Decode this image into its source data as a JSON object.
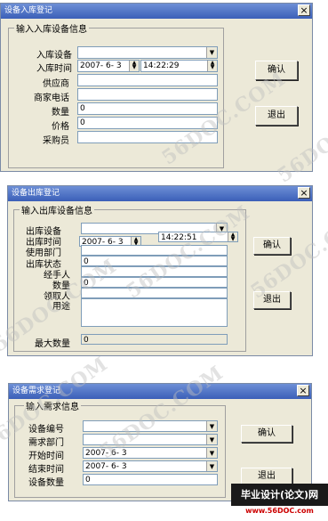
{
  "window1": {
    "title": "设备入库登记",
    "group_title": "输入入库设备信息",
    "labels": {
      "device": "入库设备",
      "time": "入库时间",
      "supplier": "供应商",
      "phone": "商家电话",
      "qty": "数量",
      "price": "价格",
      "buyer": "采购员"
    },
    "values": {
      "device": "",
      "date": "2007- 6- 3",
      "time": "14:22:29",
      "supplier": "",
      "phone": "",
      "qty": "0",
      "price": "0",
      "buyer": ""
    },
    "confirm_label": "确认",
    "exit_label": "退出",
    "close_glyph": "×"
  },
  "window2": {
    "title": "设备出库登记",
    "group_title": "输入出库设备信息",
    "labels": {
      "device": "出库设备",
      "time": "出库时间",
      "dept": "使用部门",
      "status": "出库状态",
      "handler": "经手人",
      "qty": "数量",
      "receiver": "领取人",
      "purpose": "用途",
      "max_qty": "最大数量"
    },
    "values": {
      "device": "",
      "date": "2007- 6- 3",
      "time": "14:22:51",
      "dept": "",
      "status": "0",
      "handler": "",
      "qty": "0",
      "receiver": "",
      "purpose": "",
      "max_qty": "0"
    },
    "confirm_label": "确认",
    "exit_label": "退出",
    "close_glyph": "×"
  },
  "window3": {
    "title": "设备需求登记",
    "group_title": "输入需求信息",
    "labels": {
      "device_id": "设备编号",
      "dept": "需求部门",
      "start": "开始时间",
      "end": "结束时间",
      "qty": "设备数量"
    },
    "values": {
      "device_id": "",
      "dept": "",
      "start": "2007- 6- 3",
      "end": "2007- 6- 3",
      "qty": "0"
    },
    "confirm_label": "确认",
    "exit_label": "退出",
    "close_glyph": "×"
  },
  "watermark": "56DOC.COM",
  "footer": {
    "main": "毕业设计(论文)网",
    "url": "www.56DOC.com"
  },
  "colors": {
    "window_bg": "#ece9d8",
    "titlebar": "#3b5fb8",
    "field_border": "#7f9db9"
  }
}
